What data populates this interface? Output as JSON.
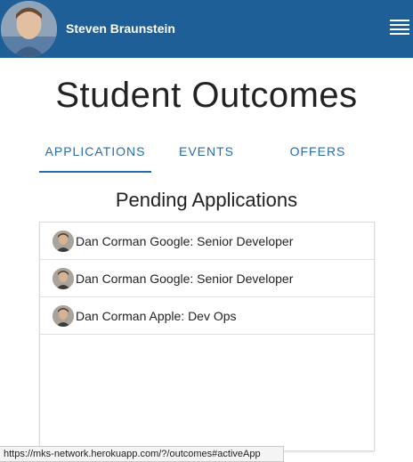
{
  "header": {
    "user_name": "Steven Braunstein",
    "menu_icon": "hamburger-menu-icon",
    "brand_color": "#1f5f98"
  },
  "page": {
    "title": "Student Outcomes"
  },
  "tabs": [
    {
      "label": "APPLICATIONS",
      "active": true
    },
    {
      "label": "EVENTS",
      "active": false
    },
    {
      "label": "OFFERS",
      "active": false
    }
  ],
  "section": {
    "title": "Pending Applications"
  },
  "applications": [
    {
      "text": "Dan Corman Google: Senior Developer"
    },
    {
      "text": "Dan Corman Google: Senior Developer"
    },
    {
      "text": "Dan Corman Apple: Dev Ops"
    }
  ],
  "status_bar": {
    "url": "https://mks-network.herokuapp.com/?/outcomes#activeApp"
  }
}
